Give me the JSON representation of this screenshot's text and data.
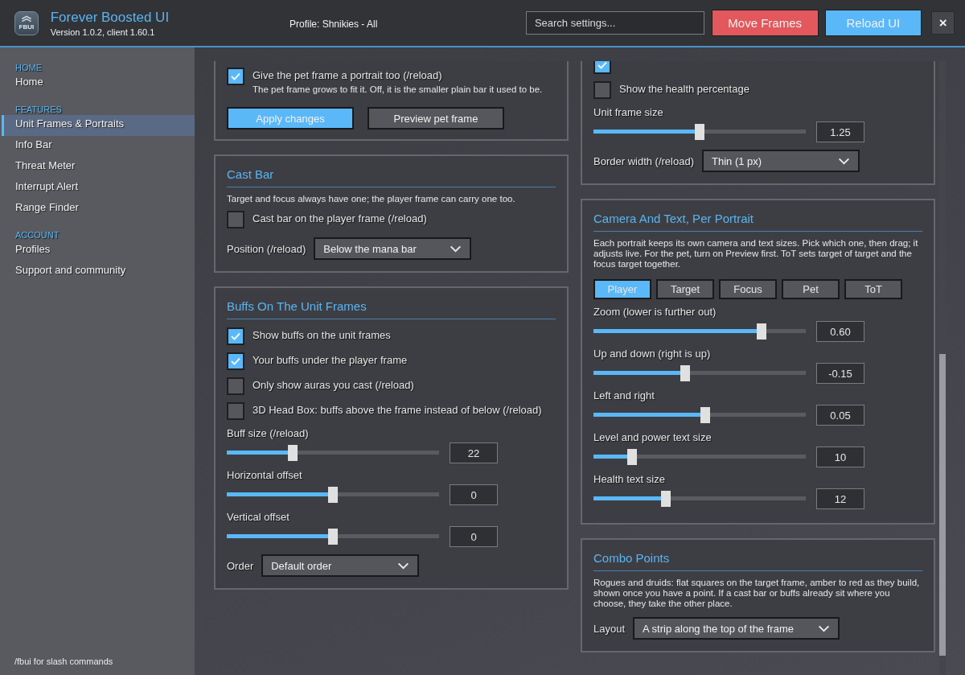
{
  "header": {
    "logo_text": "FBUI",
    "title": "Forever Boosted UI",
    "version": "Version 1.0.2, client 1.60.1",
    "profile": "Profile: Shnikies - All",
    "search": {
      "placeholder": "Search settings..."
    },
    "buttons": [
      {
        "label": "Move Frames"
      },
      {
        "label": "Reload UI"
      },
      {
        "label": "×"
      }
    ]
  },
  "sidebar": {
    "sections": [
      {
        "heading": "HOME",
        "items": [
          {
            "label": "Home",
            "selected": false
          }
        ]
      },
      {
        "heading": "FEATURES",
        "items": [
          {
            "label": "Unit Frames & Portraits",
            "selected": true
          },
          {
            "label": "Info Bar",
            "selected": false
          },
          {
            "label": "Threat Meter",
            "selected": false
          },
          {
            "label": "Interrupt Alert",
            "selected": false
          },
          {
            "label": "Range Finder",
            "selected": false
          }
        ]
      },
      {
        "heading": "ACCOUNT",
        "items": [
          {
            "label": "Profiles",
            "selected": false
          },
          {
            "label": "Support and community",
            "selected": false
          }
        ]
      }
    ],
    "footer": "/fbui for slash commands"
  },
  "left_column": [
    {
      "items": [
        {
          "kind": "checkbox",
          "label": "Give the pet frame a portrait too (/reload)",
          "checked": true,
          "description": "The pet frame grows to fit it.  Off, it is the smaller plain bar it used to be."
        },
        {
          "kind": "buttons",
          "buttons": [
            {
              "label": "Apply changes"
            },
            {
              "label": "Preview pet frame"
            }
          ]
        }
      ]
    },
    {
      "title": "Cast Bar",
      "items": [
        {
          "kind": "text",
          "text": "Target and focus always have one; the player frame can carry one too."
        },
        {
          "kind": "checkbox",
          "label": "Cast bar on the player frame (/reload)",
          "checked": false
        },
        {
          "kind": "dropdown",
          "label": "Position (/reload)",
          "value": "Below the mana bar"
        }
      ]
    },
    {
      "title": "Buffs On The Unit Frames",
      "items": [
        {
          "kind": "checkbox",
          "label": "Show buffs on the unit frames",
          "checked": true
        },
        {
          "kind": "checkbox",
          "label": "Your buffs under the player frame",
          "checked": true
        },
        {
          "kind": "checkbox",
          "label": "Only show auras you cast (/reload)",
          "checked": false
        },
        {
          "kind": "checkbox",
          "label": "3D Head Box: buffs above the frame instead of below (/reload)",
          "checked": false
        },
        {
          "kind": "slider",
          "label": "Buff size (/reload)",
          "level": 0.31,
          "value": "22"
        },
        {
          "kind": "slider",
          "label": "Horizontal offset",
          "level": 0.5,
          "value": "0"
        },
        {
          "kind": "slider",
          "label": "Vertical offset",
          "level": 0.5,
          "value": "0"
        },
        {
          "kind": "dropdown",
          "label": "Order",
          "value": "Default order"
        }
      ]
    }
  ],
  "right_column": [
    {
      "items": [
        {
          "kind": "checkbox",
          "checked": true
        },
        {
          "kind": "checkbox",
          "label": "Show the health percentage",
          "checked": false
        },
        {
          "kind": "slider",
          "label": "Unit frame size",
          "level": 0.5,
          "value": "1.25"
        },
        {
          "kind": "dropdown",
          "label": "Border width (/reload)",
          "value": "Thin (1 px)"
        }
      ]
    },
    {
      "title": "Camera And Text, Per Portrait",
      "items": [
        {
          "kind": "text",
          "text": "Each portrait keeps its own camera and text sizes.  Pick which one, then drag; it adjusts live.  For the pet, turn on Preview first.  ToT sets target of target and the focus target together."
        },
        {
          "kind": "tabs",
          "tabs": [
            {
              "label": "Player",
              "selected": true
            },
            {
              "label": "Target",
              "selected": false
            },
            {
              "label": "Focus",
              "selected": false
            },
            {
              "label": "Pet",
              "selected": false
            },
            {
              "label": "ToT",
              "selected": false
            }
          ]
        },
        {
          "kind": "slider",
          "label": "Zoom (lower is further out)",
          "level": 0.79,
          "value": "0.60"
        },
        {
          "kind": "slider",
          "label": "Up and down (right is up)",
          "level": 0.43,
          "value": "-0.15"
        },
        {
          "kind": "slider",
          "label": "Left and right",
          "level": 0.525,
          "value": "0.05"
        },
        {
          "kind": "slider",
          "label": "Level and power text size",
          "level": 0.18,
          "value": "10"
        },
        {
          "kind": "slider",
          "label": "Health text size",
          "level": 0.34,
          "value": "12"
        }
      ]
    },
    {
      "title": "Combo Points",
      "items": [
        {
          "kind": "text",
          "text": "Rogues and druids: flat squares on the target frame, amber to red as they build, shown once you have a point.  If a cast bar or buffs already sit where you choose, they take the other place."
        },
        {
          "kind": "dropdown",
          "label": "Layout",
          "value": "A strip along the top of the frame"
        }
      ]
    }
  ]
}
